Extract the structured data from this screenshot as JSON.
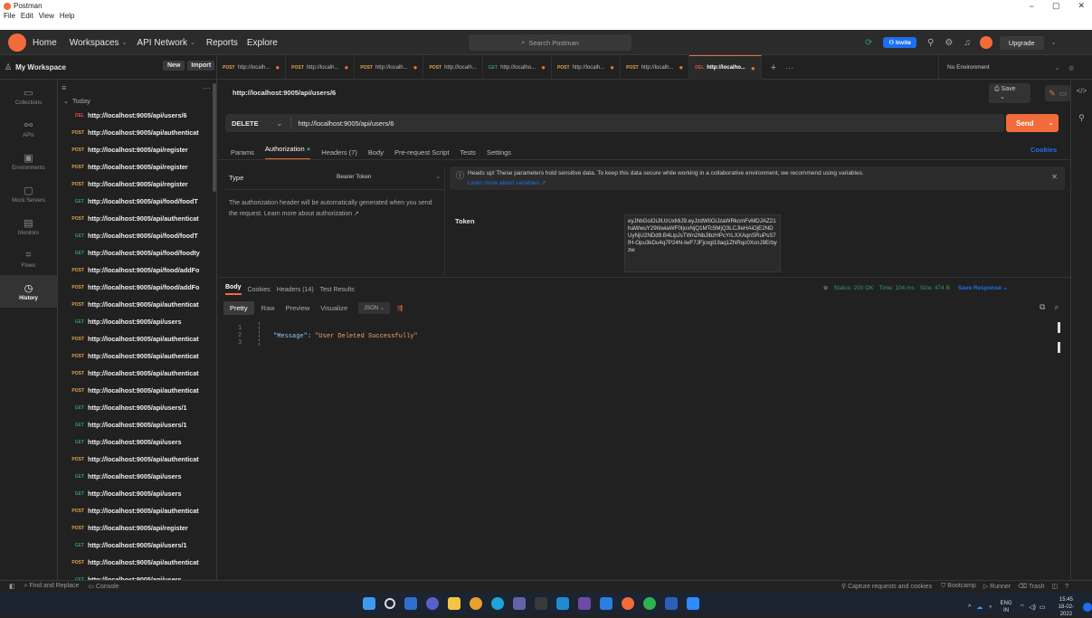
{
  "window": {
    "title": "Postman"
  },
  "menu": [
    "File",
    "Edit",
    "View",
    "Help"
  ],
  "header": {
    "home": "Home",
    "workspaces": "Workspaces",
    "api_network": "API Network",
    "reports": "Reports",
    "explore": "Explore",
    "search_placeholder": "Search Postman",
    "invite": "Invite",
    "upgrade": "Upgrade"
  },
  "workspace": {
    "name": "My Workspace",
    "new_label": "New",
    "import_label": "Import"
  },
  "tabs": [
    {
      "method": "POST",
      "label": "http://localh...",
      "dirty": true
    },
    {
      "method": "POST",
      "label": "http://localh...",
      "dirty": true
    },
    {
      "method": "POST",
      "label": "http://localh...",
      "dirty": true
    },
    {
      "method": "POST",
      "label": "http://localh...",
      "dirty": false
    },
    {
      "method": "GET",
      "label": "http://localho...",
      "dirty": true
    },
    {
      "method": "POST",
      "label": "http://localh...",
      "dirty": true
    },
    {
      "method": "POST",
      "label": "http://localh...",
      "dirty": true
    },
    {
      "method": "DEL",
      "label": "http://localho...",
      "dirty": true,
      "active": true
    }
  ],
  "environment": "No Environment",
  "leftnav": [
    {
      "icon": "collections-icon",
      "label": "Collections"
    },
    {
      "icon": "apis-icon",
      "label": "APIs"
    },
    {
      "icon": "environments-icon",
      "label": "Environments"
    },
    {
      "icon": "mock-servers-icon",
      "label": "Mock Servers"
    },
    {
      "icon": "monitors-icon",
      "label": "Monitors"
    },
    {
      "icon": "flows-icon",
      "label": "Flows"
    },
    {
      "icon": "history-icon",
      "label": "History",
      "active": true
    }
  ],
  "history": {
    "group": "Today",
    "items": [
      {
        "method": "DEL",
        "url": "http://localhost:9005/api/users/6"
      },
      {
        "method": "POST",
        "url": "http://localhost:9005/api/authenticat"
      },
      {
        "method": "POST",
        "url": "http://localhost:9005/api/register"
      },
      {
        "method": "POST",
        "url": "http://localhost:9005/api/register"
      },
      {
        "method": "POST",
        "url": "http://localhost:9005/api/register"
      },
      {
        "method": "GET",
        "url": "http://localhost:9005/api/food/foodT"
      },
      {
        "method": "POST",
        "url": "http://localhost:9005/api/authenticat"
      },
      {
        "method": "GET",
        "url": "http://localhost:9005/api/food/foodT"
      },
      {
        "method": "GET",
        "url": "http://localhost:9005/api/food/foodty"
      },
      {
        "method": "POST",
        "url": "http://localhost:9005/api/food/addFo"
      },
      {
        "method": "POST",
        "url": "http://localhost:9005/api/food/addFo"
      },
      {
        "method": "POST",
        "url": "http://localhost:9005/api/authenticat"
      },
      {
        "method": "GET",
        "url": "http://localhost:9005/api/users"
      },
      {
        "method": "POST",
        "url": "http://localhost:9005/api/authenticat"
      },
      {
        "method": "POST",
        "url": "http://localhost:9005/api/authenticat"
      },
      {
        "method": "POST",
        "url": "http://localhost:9005/api/authenticat"
      },
      {
        "method": "POST",
        "url": "http://localhost:9005/api/authenticat"
      },
      {
        "method": "GET",
        "url": "http://localhost:9005/api/users/1"
      },
      {
        "method": "GET",
        "url": "http://localhost:9005/api/users/1"
      },
      {
        "method": "GET",
        "url": "http://localhost:9005/api/users"
      },
      {
        "method": "POST",
        "url": "http://localhost:9005/api/authenticat"
      },
      {
        "method": "GET",
        "url": "http://localhost:9005/api/users"
      },
      {
        "method": "GET",
        "url": "http://localhost:9005/api/users"
      },
      {
        "method": "POST",
        "url": "http://localhost:9005/api/authenticat"
      },
      {
        "method": "POST",
        "url": "http://localhost:9005/api/register"
      },
      {
        "method": "GET",
        "url": "http://localhost:9005/api/users/1"
      },
      {
        "method": "POST",
        "url": "http://localhost:9005/api/authenticat"
      },
      {
        "method": "GET",
        "url": "http://localhost:9005/api/users"
      },
      {
        "method": "POST",
        "url": "http://localhost:9005/api/authenticat"
      }
    ]
  },
  "request": {
    "title": "http://localhost:9005/api/users/6",
    "save": "Save",
    "method": "DELETE",
    "url": "http://localhost:9005/api/users/6",
    "send": "Send",
    "tabs": [
      "Params",
      "Authorization",
      "Headers (7)",
      "Body",
      "Pre-request Script",
      "Tests",
      "Settings"
    ],
    "cookies": "Cookies"
  },
  "auth": {
    "type_label": "Type",
    "type_value": "Bearer Token",
    "help": "The authorization header will be automatically generated when you send the request. Learn more about authorization ↗",
    "banner": "Heads up! These parameters hold sensitive data. To keep this data secure while working in a collaborative environment, we recommend using variables.",
    "banner_link": "Learn more about variables ↗",
    "token_label": "Token",
    "token": "eyJhbGciOiJIUzUxMiJ9.eyJzdWIiOiJzaWRkcmFvMDJAZ21haWwuY29tIiwiaWF0IjoxNjQ1MTc5MjQ3LCJleHAiOjE2NDUyNjU2NDd9.B4LipJsTWn2NbJlbzHPcYrLXXAqnSRuPsS7fH-Opu3kDu4q7P24N-twF7JFjcxgl19aq1ZNRqc0XcnJ9Erbyzw"
  },
  "response": {
    "tabs": [
      "Body",
      "Cookies",
      "Headers (14)",
      "Test Results"
    ],
    "status": "Status: 200 OK",
    "time": "Time: 104 ms",
    "size": "Size: 474 B",
    "save": "Save Response",
    "views": [
      "Pretty",
      "Raw",
      "Preview",
      "Visualize"
    ],
    "format": "JSON",
    "lines": [
      "1",
      "2",
      "3"
    ],
    "code_key": "\"Message\"",
    "code_value": "\"User Deleted Successfully\""
  },
  "statusbar": {
    "find": "Find and Replace",
    "console": "Console",
    "capture": "Capture requests and cookies",
    "bootcamp": "Bootcamp",
    "runner": "Runner",
    "trash": "Trash"
  },
  "taskbar": {
    "lang": "ENG",
    "region": "IN",
    "time": "15:45",
    "date": "18-02-2022"
  }
}
